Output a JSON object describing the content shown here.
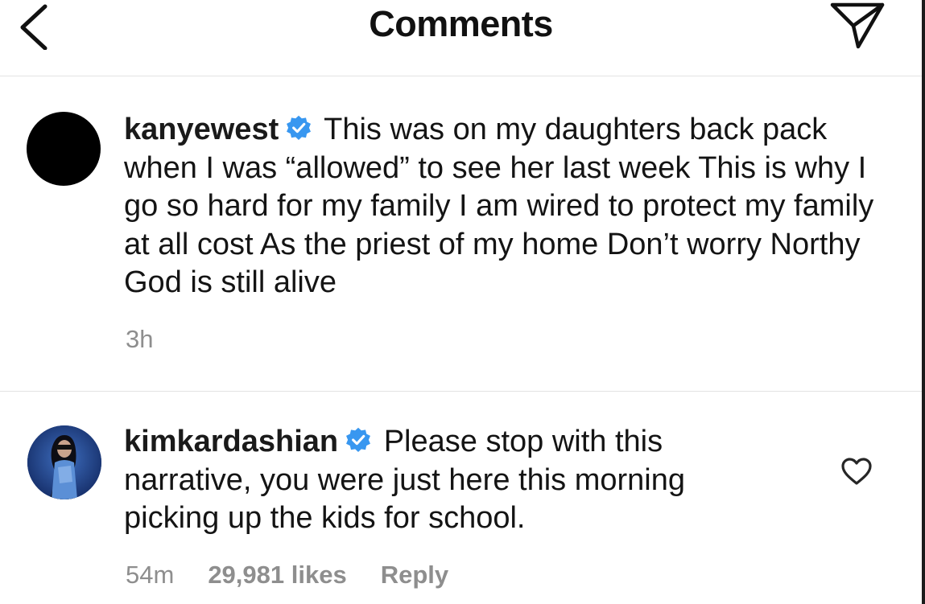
{
  "header": {
    "title": "Comments"
  },
  "comments": [
    {
      "username": "kanyewest",
      "verified": true,
      "text": "This was on my daughters back pack when I was “allowed” to see her last week This is why I go so hard for my family  I am wired to protect my family at all cost  As the priest of my home  Don’t worry Northy  God is still alive",
      "time": "3h"
    },
    {
      "username": "kimkardashian",
      "verified": true,
      "text": "Please stop with this narrative, you were just here this morning picking up the kids for school.",
      "time": "54m",
      "likes": "29,981 likes",
      "reply_label": "Reply"
    }
  ],
  "colors": {
    "verified_badge": "#3897f0",
    "meta_text": "#8e8e8e",
    "divider": "#e3e3e3"
  },
  "icons": {
    "back": "chevron-left-icon",
    "share": "paper-plane-icon",
    "like": "heart-outline-icon",
    "verified": "verified-badge-icon"
  }
}
